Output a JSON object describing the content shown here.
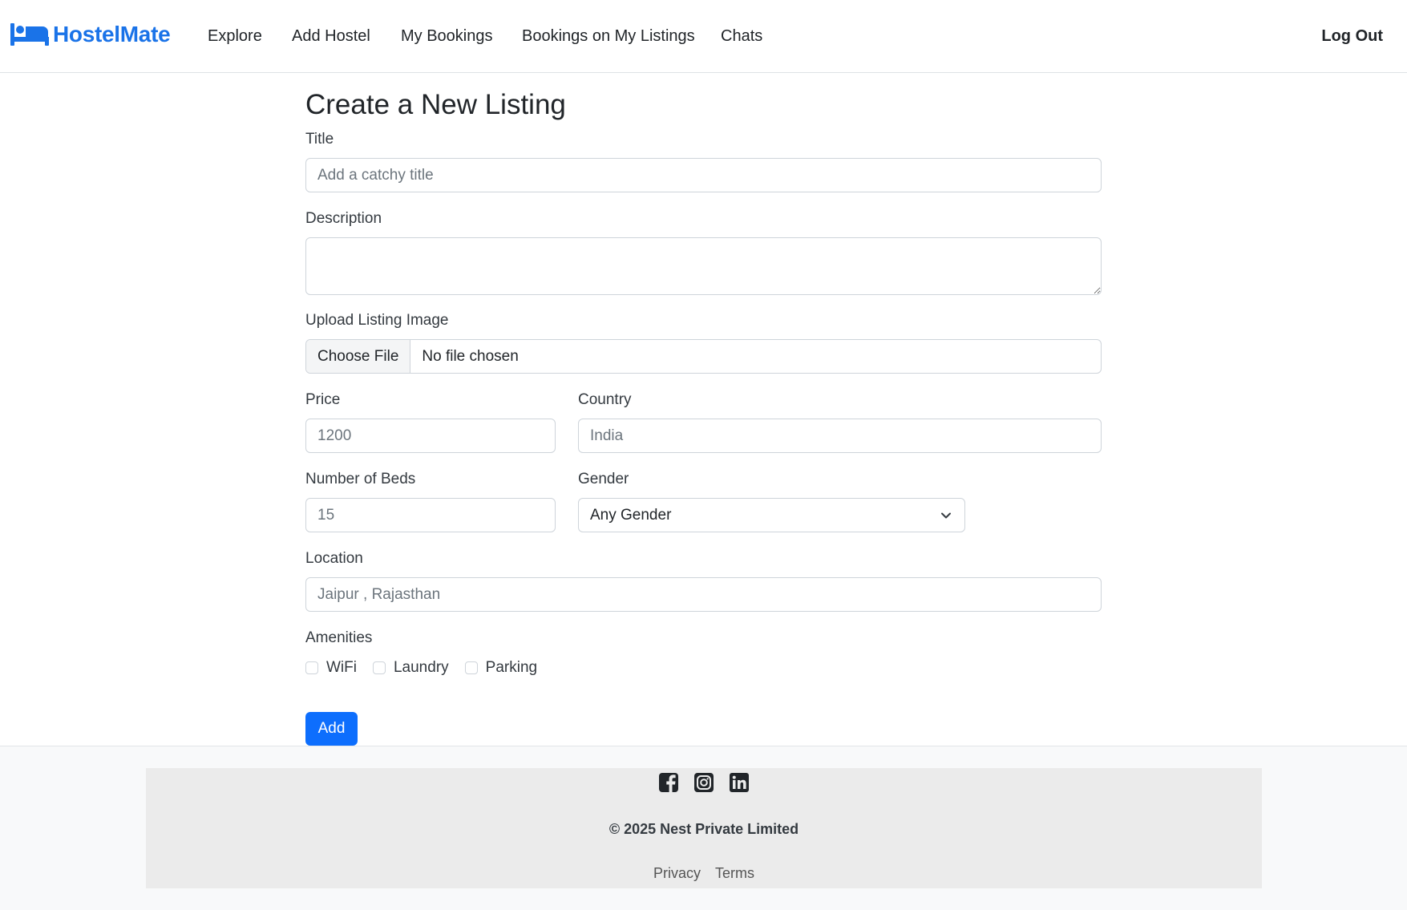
{
  "brand": {
    "name": "HostelMate",
    "color": "#1a73e8"
  },
  "nav": {
    "links": [
      "Explore",
      "Add Hostel",
      "My Bookings",
      "Bookings on My Listings",
      "Chats"
    ],
    "logout": "Log Out"
  },
  "form": {
    "heading": "Create a New Listing",
    "title": {
      "label": "Title",
      "placeholder": "Add a catchy title"
    },
    "description": {
      "label": "Description",
      "placeholder": ""
    },
    "image": {
      "label": "Upload Listing Image",
      "button": "Choose File",
      "status": "No file chosen"
    },
    "price": {
      "label": "Price",
      "placeholder": "1200"
    },
    "country": {
      "label": "Country",
      "placeholder": "India"
    },
    "beds": {
      "label": "Number of Beds",
      "placeholder": "15"
    },
    "gender": {
      "label": "Gender",
      "selected": "Any Gender"
    },
    "location": {
      "label": "Location",
      "placeholder": "Jaipur , Rajasthan"
    },
    "amenities": {
      "label": "Amenities",
      "options": [
        "WiFi",
        "Laundry",
        "Parking"
      ]
    },
    "submit": "Add",
    "accent": "#0d6efd"
  },
  "footer": {
    "socials": [
      "facebook-icon",
      "instagram-icon",
      "linkedin-icon"
    ],
    "copyright": "© 2025 Nest Private Limited",
    "links": [
      "Privacy",
      "Terms"
    ]
  }
}
